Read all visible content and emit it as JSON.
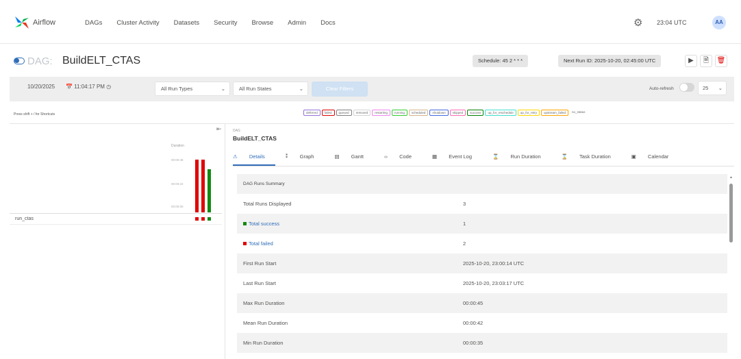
{
  "app": {
    "logo_text": "Airflow"
  },
  "nav": [
    "DAGs",
    "Cluster Activity",
    "Datasets",
    "Security",
    "Browse",
    "Admin",
    "Docs"
  ],
  "header": {
    "time": "23:04 UTC",
    "avatar": "AA"
  },
  "dag": {
    "prefix": "DAG:",
    "name": "BuildELT_CTAS",
    "schedule": "Schedule: 45 2 * * *",
    "next_run": "Next Run ID: 2025-10-20, 02:45:00 UTC"
  },
  "filters": {
    "date": "10/20/2025",
    "time": "11:04:17 PM",
    "run_types": "All Run Types",
    "run_states": "All Run States",
    "clear": "Clear Filters",
    "auto_refresh": "Auto-refresh",
    "count": "25"
  },
  "shortcut_hint": "Press shift + / for Shortcuts",
  "legend": [
    "deferred",
    "failed",
    "queued",
    "removed",
    "restarting",
    "running",
    "scheduled",
    "shutdown",
    "skipped",
    "success",
    "up_for_reschedule",
    "up_for_retry",
    "upstream_failed",
    "no_status"
  ],
  "grid": {
    "duration_title": "Duration",
    "duration_ticks": [
      "00:00:45",
      "00:00:22",
      "00:00:00"
    ],
    "task": "run_ctas",
    "runs": [
      {
        "state": "failed",
        "duration_frac": 1.0,
        "color": "#e00000"
      },
      {
        "state": "failed",
        "duration_frac": 1.0,
        "color": "#e00000"
      },
      {
        "state": "success",
        "duration_frac": 0.82,
        "color": "#118a11"
      }
    ]
  },
  "details": {
    "small": "DAG",
    "title": "BuildELT_CTAS",
    "tabs": [
      "Details",
      "Graph",
      "Gantt",
      "Code",
      "Event Log",
      "Run Duration",
      "Task Duration",
      "Calendar"
    ],
    "summary_title": "DAG Runs Summary",
    "rows": [
      {
        "k": "Total Runs Displayed",
        "v": "3"
      },
      {
        "k": "Total success",
        "v": "1",
        "color": "#118a11",
        "link": true
      },
      {
        "k": "Total failed",
        "v": "2",
        "color": "#e00000",
        "link": true
      },
      {
        "k": "First Run Start",
        "v": "2025-10-20, 23:00:14 UTC"
      },
      {
        "k": "Last Run Start",
        "v": "2025-10-20, 23:03:17 UTC"
      },
      {
        "k": "Max Run Duration",
        "v": "00:00:45"
      },
      {
        "k": "Mean Run Duration",
        "v": "00:00:42"
      },
      {
        "k": "Min Run Duration",
        "v": "00:00:35"
      }
    ]
  }
}
